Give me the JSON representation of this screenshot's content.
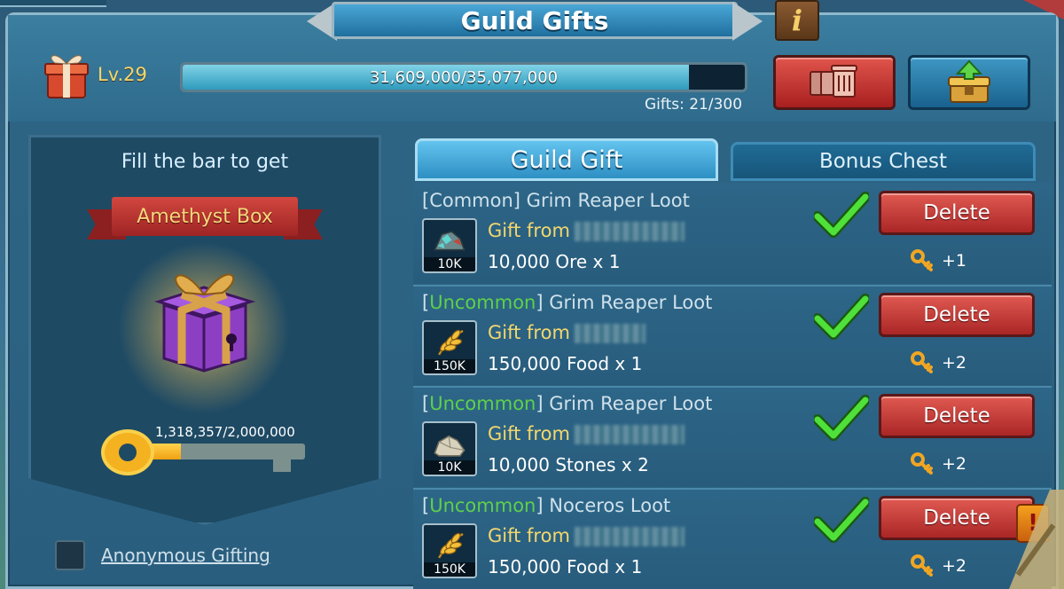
{
  "header": {
    "title": "Guild Gifts",
    "info_label": "i",
    "level": "Lv.29",
    "progress_text": "31,609,000/35,077,000",
    "progress_fraction": 0.901,
    "gifts_count": "Gifts: 21/300"
  },
  "left_panel": {
    "fill_text": "Fill the bar to get",
    "reward_name": "Amethyst Box",
    "key_progress_text": "1,318,357/2,000,000",
    "key_progress_fraction": 0.659,
    "anonymous_label": "Anonymous Gifting",
    "anonymous_checked": false
  },
  "tabs": [
    {
      "label": "Guild Gift",
      "active": true
    },
    {
      "label": "Bonus Chest",
      "active": false
    }
  ],
  "gifts": [
    {
      "rarity": "Common",
      "name": "Grim Reaper Loot",
      "from_label": "Gift from",
      "reward": "10,000 Ore x 1",
      "icon": "ore-icon",
      "icon_qty": "10K",
      "delete_label": "Delete",
      "keys": "+1"
    },
    {
      "rarity": "Uncommon",
      "name": "Grim Reaper Loot",
      "from_label": "Gift from",
      "reward": "150,000 Food x 1",
      "icon": "wheat-icon",
      "icon_qty": "150K",
      "delete_label": "Delete",
      "keys": "+2"
    },
    {
      "rarity": "Uncommon",
      "name": "Grim Reaper Loot",
      "from_label": "Gift from",
      "reward": "10,000 Stones x 2",
      "icon": "stone-icon",
      "icon_qty": "10K",
      "delete_label": "Delete",
      "keys": "+2"
    },
    {
      "rarity": "Uncommon",
      "name": "Noceros Loot",
      "from_label": "Gift from",
      "reward": "150,000 Food x 1",
      "icon": "wheat-icon",
      "icon_qty": "150K",
      "delete_label": "Delete",
      "keys": "+2"
    }
  ],
  "colors": {
    "uncommon": "#5fd04a",
    "delete": "#c23a33",
    "accent": "#2e8fc3"
  }
}
